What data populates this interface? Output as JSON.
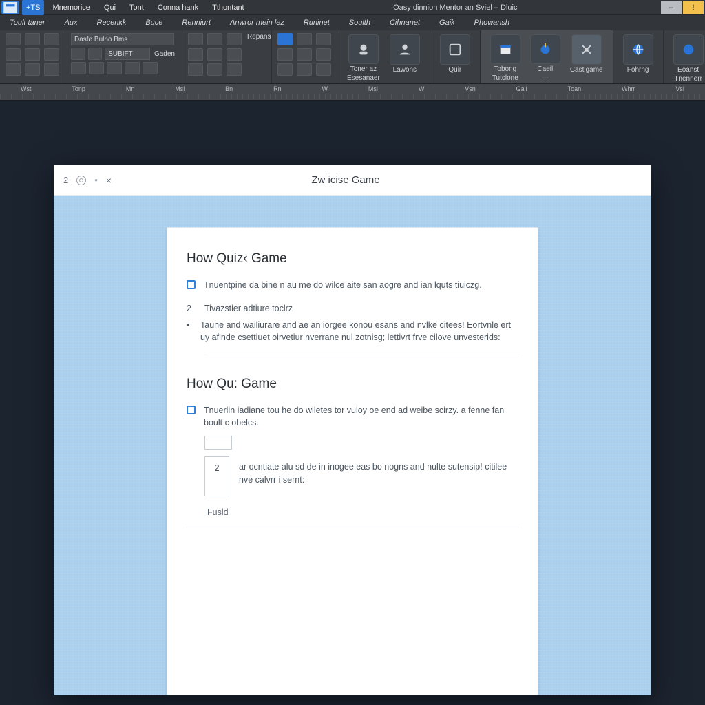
{
  "menurow1": {
    "app_badge": "A",
    "accent": "+TS",
    "items": [
      "Mnemorice",
      "Qui",
      "Tont",
      "Conna hank",
      "Tthontant"
    ],
    "title": "Oasy dinnion Mentor an Sviel – Dluic",
    "winbuttons": {
      "min": "–",
      "warn": "!"
    }
  },
  "menurow2": {
    "items": [
      "Toult taner",
      "Aux",
      "Recenkk",
      "Buce",
      "Renniurt",
      "Anwror mein lez",
      "Runinet",
      "Soulth",
      "Cihnanet",
      "Gaik",
      "Phowansh"
    ]
  },
  "ribbon": {
    "groups": [
      {
        "label": "Wst",
        "combo1": "Dasfe Bulno Bms",
        "combo2": "SUBIFT",
        "side": "Gaden"
      },
      {
        "label": "Tonp",
        "side": "Repans"
      },
      {
        "label": "Mn"
      },
      {
        "label": "W"
      }
    ],
    "bigs": [
      {
        "name": "toner-button",
        "cap1": "Toner az",
        "cap2": "Esesanaer",
        "grp": "W"
      },
      {
        "name": "lawons-button",
        "cap1": "Lawons",
        "cap2": "",
        "grp": "Vsn"
      },
      {
        "name": "quir-button",
        "cap1": "",
        "cap2": "Quir",
        "grp": "Gali"
      },
      {
        "name": "tobong-button",
        "cap1": "Tobong",
        "cap2": "Tutclone",
        "grp": ""
      },
      {
        "name": "caeil-button",
        "cap1": "Caeil",
        "cap2": "—",
        "grp": "Toan"
      },
      {
        "name": "castigame-button",
        "cap1": "",
        "cap2": "Castigame",
        "grp": ""
      },
      {
        "name": "fohrng-button",
        "cap1": "",
        "cap2": "Fohrng",
        "grp": "Whrr"
      },
      {
        "name": "eoanst-button",
        "cap1": "Eoanst",
        "cap2": "Tnennerr",
        "grp": "Vsi"
      }
    ]
  },
  "ruler": {
    "labels": [
      "Wst",
      "Tonp",
      "Mn",
      "Msl",
      "Bn",
      "Rn",
      "W",
      "Msl",
      "W",
      "Vsn",
      "Gali",
      "Toan",
      "Whrr",
      "Vsi"
    ]
  },
  "page": {
    "tb_num": "2",
    "tb_close": "×",
    "title": "Zw icise Game",
    "section1": {
      "heading": "How Quiz‹ Game",
      "chk_text": "Tnuentpine da bine n au me do wilce aite san aogre and ian lquts tiuiczg.",
      "num2": "2",
      "num2_text": "Tivazstier adtiure toclrz",
      "bullet": "•",
      "bullet_text": "Taune and wailiurare and ae an iorgee konou esans and nvlke citees! Eortvnle ert uy aflnde csettiuet oirvetiur nverrane nul zotnisg; lettivrt frve cilove unvesterids:"
    },
    "section2": {
      "heading": "How Qu: Game",
      "chk_text": "Tnuerlin iadiane tou he do wiletes tor vuloy oe end ad weibe scirzy. a fenne fan boult c obelcs.",
      "answer_num": "2",
      "answer_text": "ar ocntiate alu sd de in inogee eas bo nogns and nulte sutensip! citilee nve calvrr i sernt:",
      "footer": "Fusld"
    }
  }
}
